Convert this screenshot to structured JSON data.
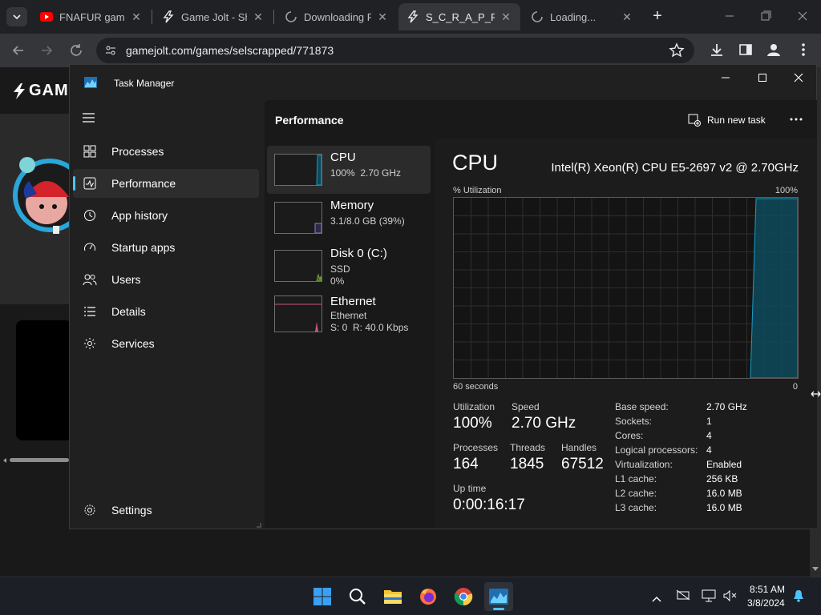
{
  "browser": {
    "tabs": [
      {
        "label": "FNAFUR game",
        "icon": "youtube-icon"
      },
      {
        "label": "Game Jolt - Sha",
        "icon": "gamejolt-icon"
      },
      {
        "label": "Downloading F",
        "icon": "loading-spinner-icon"
      },
      {
        "label": "S_C_R_A_P_P_E_",
        "icon": "gamejolt-icon"
      },
      {
        "label": "Loading...",
        "icon": "loading-spinner-icon"
      }
    ],
    "url": "gamejolt.com/games/selscrapped/771873",
    "new_tab": "+"
  },
  "page": {
    "logo_text": "GAM"
  },
  "task_manager": {
    "title": "Task Manager",
    "nav": [
      {
        "label": "Processes",
        "icon": "processes-grid-icon"
      },
      {
        "label": "Performance",
        "icon": "performance-chart-icon"
      },
      {
        "label": "App history",
        "icon": "history-clock-icon"
      },
      {
        "label": "Startup apps",
        "icon": "startup-speedometer-icon"
      },
      {
        "label": "Users",
        "icon": "users-icon"
      },
      {
        "label": "Details",
        "icon": "details-list-icon"
      },
      {
        "label": "Services",
        "icon": "services-puzzle-icon"
      }
    ],
    "settings_label": "Settings",
    "section_title": "Performance",
    "run_new_task": "Run new task",
    "perf_items": [
      {
        "name": "CPU",
        "sub1": "100%  2.70 GHz",
        "sub2": ""
      },
      {
        "name": "Memory",
        "sub1": "3.1/8.0 GB (39%)",
        "sub2": ""
      },
      {
        "name": "Disk 0 (C:)",
        "sub1": "SSD",
        "sub2": "0%"
      },
      {
        "name": "Ethernet",
        "sub1": "Ethernet",
        "sub2": "S: 0  R: 40.0 Kbps"
      }
    ],
    "cpu": {
      "title": "CPU",
      "model": "Intel(R) Xeon(R) CPU E5-2697 v2 @ 2.70GHz",
      "graph_label": "% Utilization",
      "graph_max": "100%",
      "graph_span": "60 seconds",
      "graph_min": "0",
      "stats": {
        "utilization_label": "Utilization",
        "utilization": "100%",
        "speed_label": "Speed",
        "speed": "2.70 GHz",
        "processes_label": "Processes",
        "processes": "164",
        "threads_label": "Threads",
        "threads": "1845",
        "handles_label": "Handles",
        "handles": "67512",
        "uptime_label": "Up time",
        "uptime": "0:00:16:17"
      },
      "specs": [
        {
          "k": "Base speed:",
          "v": "2.70 GHz"
        },
        {
          "k": "Sockets:",
          "v": "1"
        },
        {
          "k": "Cores:",
          "v": "4"
        },
        {
          "k": "Logical processors:",
          "v": "4"
        },
        {
          "k": "Virtualization:",
          "v": "Enabled"
        },
        {
          "k": "L1 cache:",
          "v": "256 KB"
        },
        {
          "k": "L2 cache:",
          "v": "16.0 MB"
        },
        {
          "k": "L3 cache:",
          "v": "16.0 MB"
        }
      ]
    }
  },
  "taskbar": {
    "time": "8:51 AM",
    "date": "3/8/2024",
    "apps": [
      "start-icon",
      "search-icon",
      "file-explorer-icon",
      "firefox-icon",
      "chrome-icon",
      "task-manager-icon"
    ]
  },
  "colors": {
    "accent": "#4cc2ff",
    "cpu_graph": "#1a9bc4",
    "memory_graph": "#8a7cc7",
    "disk_graph": "#7ba53c",
    "ethernet_graph": "#c9577a"
  }
}
